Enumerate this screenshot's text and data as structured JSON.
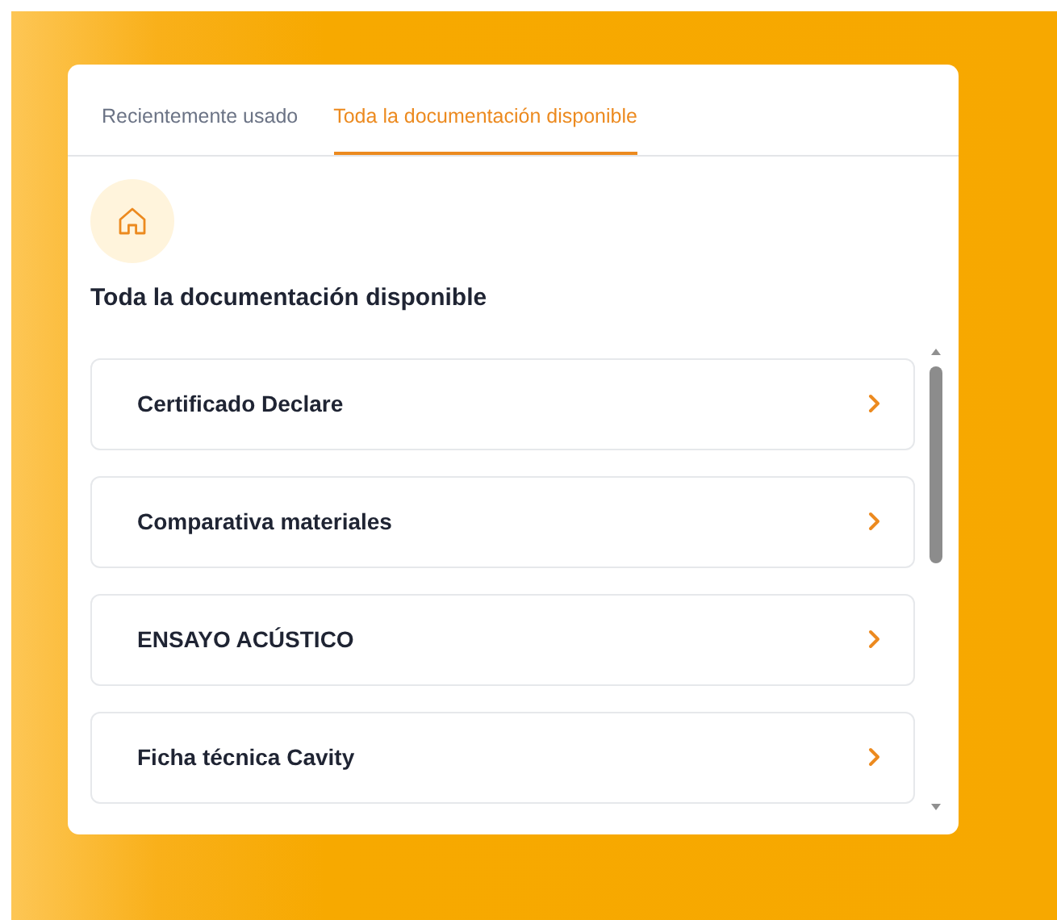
{
  "tabs": [
    {
      "label": "Recientemente usado",
      "selected": false
    },
    {
      "label": "Toda la documentación disponible",
      "selected": true
    }
  ],
  "heading": "Toda la documentación disponible",
  "documents": [
    {
      "title": "Certificado Declare"
    },
    {
      "title": "Comparativa materiales"
    },
    {
      "title": "ENSAYO ACÚSTICO"
    },
    {
      "title": "Ficha técnica Cavity"
    }
  ]
}
